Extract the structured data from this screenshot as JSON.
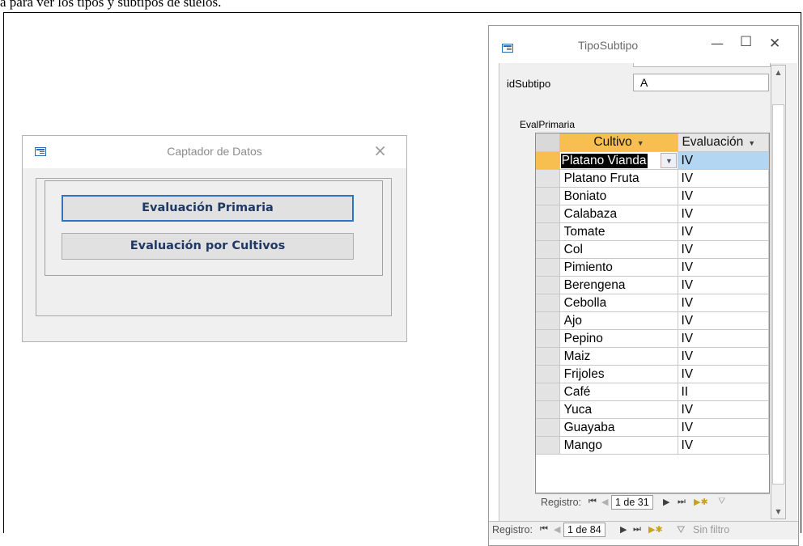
{
  "page": {
    "caption": "a para ver los tipos y subtipos de suelos."
  },
  "captador": {
    "title": "Captador de Datos",
    "close_glyph": "×",
    "buttons": [
      "Evaluación Primaria",
      "Evaluación por Cultivos"
    ]
  },
  "tipo": {
    "title": "TipoSubtipo",
    "controls": {
      "minimize": "—",
      "maximize": "☐",
      "close": "✕"
    },
    "idsubtipo_label": "idSubtipo",
    "idsubtipo_value": "A",
    "evalprimaria_label": "EvalPrimaria",
    "columns": [
      "Cultivo",
      "Evaluación"
    ],
    "rows": [
      {
        "cultivo": "Platano Vianda",
        "evaluacion": "IV"
      },
      {
        "cultivo": "Platano Fruta",
        "evaluacion": "IV"
      },
      {
        "cultivo": "Boniato",
        "evaluacion": "IV"
      },
      {
        "cultivo": "Calabaza",
        "evaluacion": "IV"
      },
      {
        "cultivo": "Tomate",
        "evaluacion": "IV"
      },
      {
        "cultivo": "Col",
        "evaluacion": "IV"
      },
      {
        "cultivo": "Pimiento",
        "evaluacion": "IV"
      },
      {
        "cultivo": "Berengena",
        "evaluacion": "IV"
      },
      {
        "cultivo": "Cebolla",
        "evaluacion": "IV"
      },
      {
        "cultivo": "Ajo",
        "evaluacion": "IV"
      },
      {
        "cultivo": "Pepino",
        "evaluacion": "IV"
      },
      {
        "cultivo": "Maiz",
        "evaluacion": "IV"
      },
      {
        "cultivo": "Frijoles",
        "evaluacion": "IV"
      },
      {
        "cultivo": "Café",
        "evaluacion": "II"
      },
      {
        "cultivo": "Yuca",
        "evaluacion": "IV"
      },
      {
        "cultivo": "Guayaba",
        "evaluacion": "IV"
      },
      {
        "cultivo": "Mango",
        "evaluacion": "IV"
      }
    ],
    "subform_nav": {
      "label": "Registro:",
      "position": "1 de 31"
    },
    "main_nav": {
      "label": "Registro:",
      "position": "1 de 84",
      "filter": "Sin filtro"
    }
  },
  "colors": {
    "selected_header": "#f6bf4f",
    "selected_cell": "#b3d7f3",
    "button_text": "#1f3864",
    "focus_border": "#2c75c4"
  },
  "icons": [
    "form-icon",
    "close-icon",
    "minimize-icon",
    "maximize-icon",
    "dropdown-arrow-icon",
    "filter-icon",
    "new-record-icon"
  ]
}
